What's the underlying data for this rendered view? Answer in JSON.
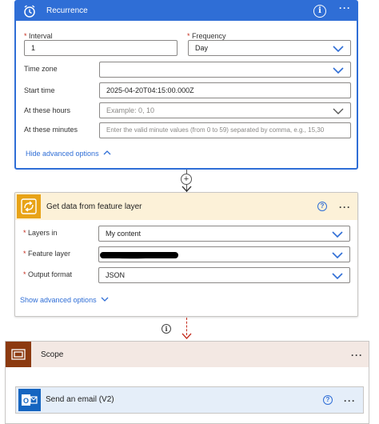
{
  "recurrence": {
    "title": "Recurrence",
    "interval": {
      "label": "Interval",
      "required_mark": "*",
      "value": "1"
    },
    "frequency": {
      "label": "Frequency",
      "required_mark": "*",
      "value": "Day"
    },
    "time_zone": {
      "label": "Time zone",
      "value": ""
    },
    "start_time": {
      "label": "Start time",
      "value": "2025-04-20T04:15:00.000Z"
    },
    "at_hours": {
      "label": "At these hours",
      "placeholder": "Example: 0, 10"
    },
    "at_minutes": {
      "label": "At these minutes",
      "placeholder": "Enter the valid minute values (from 0 to 59) separated by comma, e.g., 15,30"
    },
    "advanced_link": "Hide advanced options"
  },
  "feature_layer": {
    "title": "Get data from feature layer",
    "layers_in": {
      "label": "Layers in",
      "required_mark": "*",
      "value": "My content"
    },
    "feature_layer": {
      "label": "Feature layer",
      "required_mark": "*",
      "value": ""
    },
    "output_format": {
      "label": "Output format",
      "required_mark": "*",
      "value": "JSON"
    },
    "advanced_link": "Show advanced options"
  },
  "scope": {
    "title": "Scope"
  },
  "send_email": {
    "title": "Send an email (V2)"
  },
  "icons": {
    "info": "i",
    "help": "?",
    "more": "···",
    "plus": "+"
  },
  "colors": {
    "recurrence_accent": "#2f6ed6",
    "feature_layer_accent": "#e8a317",
    "scope_accent": "#8c3a10",
    "email_accent": "#1565c0",
    "link": "#2f6ed6",
    "required": "#c42b1c"
  }
}
